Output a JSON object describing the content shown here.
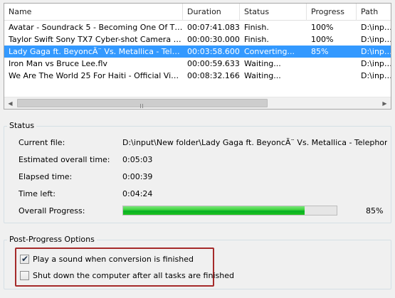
{
  "file_list": {
    "columns": [
      "Name",
      "Duration",
      "Status",
      "Progress",
      "Path"
    ],
    "rows": [
      {
        "name": "Avatar - Soundrack 5 - Becoming One Of The P...",
        "duration": "00:07:41.083",
        "status": "Finish.",
        "progress": "100%",
        "path": "D:\\input",
        "selected": false
      },
      {
        "name": "Taylor Swift Sony TX7 Cyber-shot Camera Com...",
        "duration": "00:00:30.000",
        "status": "Finish.",
        "progress": "100%",
        "path": "D:\\input",
        "selected": false
      },
      {
        "name": "Lady Gaga ft. BeyoncÃ¨ Vs. Metallica - Telepho...",
        "duration": "00:03:58.600",
        "status": "Converting...",
        "progress": "85%",
        "path": "D:\\input",
        "selected": true
      },
      {
        "name": "Iron Man vs Bruce Lee.flv",
        "duration": "00:00:59.633",
        "status": "Waiting...",
        "progress": "",
        "path": "D:\\input",
        "selected": false
      },
      {
        "name": "We Are The World 25 For Haiti - Official Video.w...",
        "duration": "00:08:32.166",
        "status": "Waiting...",
        "progress": "",
        "path": "D:\\input",
        "selected": false
      }
    ],
    "scrollbar": {
      "left_arrow_icon": "arrow-left-icon",
      "right_arrow_icon": "arrow-right-icon",
      "thumb_grip": "grip-icon"
    }
  },
  "status": {
    "title": "Status",
    "current_file_label": "Current file:",
    "current_file_value": "D:\\input\\New folder\\Lady Gaga ft. BeyoncÃ¨ Vs. Metallica - Telephone Vs. En",
    "estimated_label": "Estimated overall time:",
    "estimated_value": "0:05:03",
    "elapsed_label": "Elapsed time:",
    "elapsed_value": "0:00:39",
    "time_left_label": "Time left:",
    "time_left_value": "0:04:24",
    "overall_label": "Overall Progress:",
    "overall_value": 85,
    "overall_text": "85%",
    "progress_color": "#06b025"
  },
  "post_options": {
    "title": "Post-Progress Options",
    "play_sound_label": "Play a sound when conversion is finished",
    "play_sound_checked": true,
    "shutdown_label": "Shut down the computer after all tasks are finished",
    "shutdown_checked": false,
    "highlight_color": "#a52a2a"
  },
  "colors": {
    "selection": "#3399ff",
    "background": "#f0f0f0"
  }
}
